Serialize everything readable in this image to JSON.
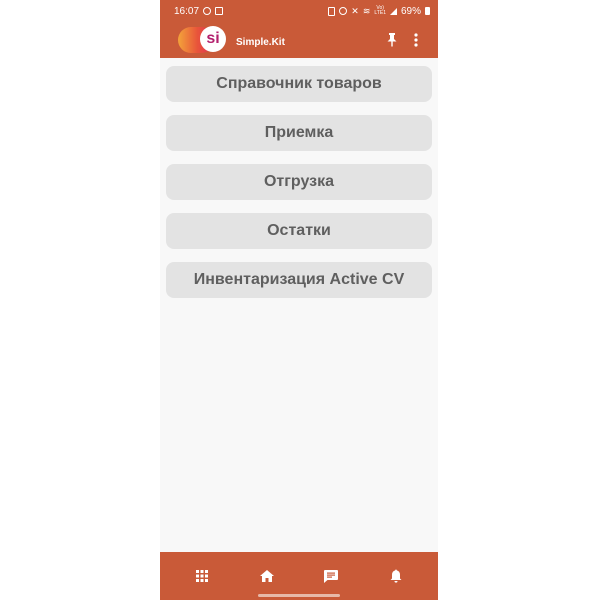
{
  "status_bar": {
    "time": "16:07",
    "net_label_top": "Vo)",
    "net_label_bottom": "LTE1",
    "battery": "69%"
  },
  "app_bar": {
    "logo_text": "si",
    "title": "Simple.Kit",
    "pin_icon": "pin-icon",
    "more_icon": "more-vert-icon"
  },
  "menu": {
    "items": [
      {
        "label": "Справочник товаров"
      },
      {
        "label": "Приемка"
      },
      {
        "label": "Отгрузка"
      },
      {
        "label": "Остатки"
      },
      {
        "label": "Инвентаризация Active CV"
      }
    ]
  },
  "bottom_nav": {
    "icons": [
      "apps-grid-icon",
      "home-icon",
      "chat-icon",
      "bell-icon"
    ]
  },
  "colors": {
    "brand": "#c95a38",
    "button_bg": "#e3e3e3",
    "button_text": "#5f5f5f",
    "background": "#f8f8f8"
  }
}
